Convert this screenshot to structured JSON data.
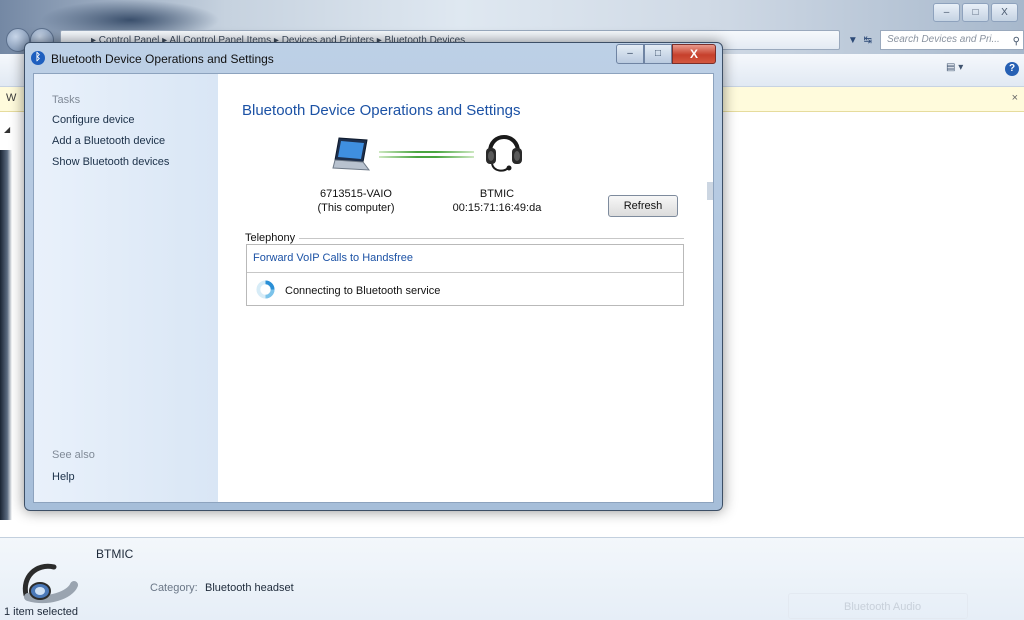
{
  "background_window": {
    "breadcrumb": "▸ Control Panel ▸ All Control Panel Items ▸ Devices and Printers ▸ Bluetooth Devices",
    "search_placeholder": "Search Devices and Pri...",
    "caption_buttons": {
      "minimize": "–",
      "maximize": "□",
      "close": "X"
    },
    "infobar_prefix": "W",
    "infobar_close": "×",
    "details": {
      "device_name": "BTMIC",
      "category_label": "Category:",
      "category_value": "Bluetooth headset"
    },
    "status_text": "1 item selected",
    "ghost_item": "Bluetooth Audio"
  },
  "dialog": {
    "title": "Bluetooth Device Operations and Settings",
    "caption_buttons": {
      "minimize": "–",
      "maximize": "□",
      "close": "X"
    },
    "tasks": {
      "heading": "Tasks",
      "items": [
        "Configure device",
        "Add a Bluetooth device",
        "Show Bluetooth devices"
      ]
    },
    "see_also": {
      "heading": "See also",
      "help": "Help"
    },
    "main": {
      "title": "Bluetooth Device Operations and Settings",
      "computer": {
        "name": "6713515-VAIO",
        "subtitle": "(This computer)"
      },
      "device": {
        "name": "BTMIC",
        "address": "00:15:71:16:49:da"
      },
      "refresh_button": "Refresh",
      "telephony": {
        "label": "Telephony",
        "service_link": "Forward VoIP Calls to Handsfree",
        "status": "Connecting to Bluetooth service"
      }
    }
  },
  "colors": {
    "link_blue": "#1c52a5",
    "connection_green": "#4aa540",
    "tasks_pane": "#e3edf9",
    "close_red": "#c6402c"
  }
}
